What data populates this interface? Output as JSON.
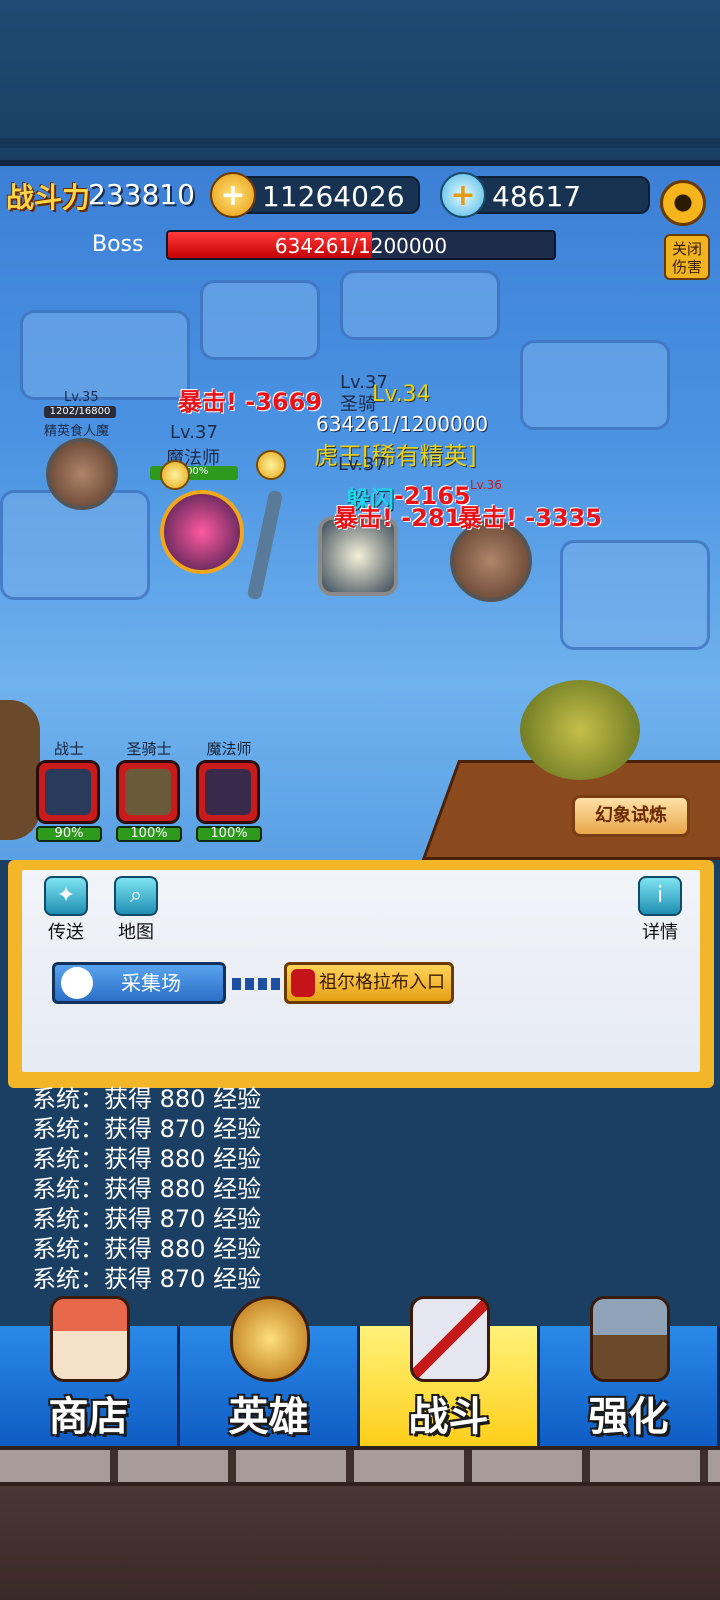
{
  "hud": {
    "power_label": "战斗力",
    "power_value": "233810",
    "gold_value": "11264026",
    "gem_value": "48617",
    "settings_icon": "gear-icon"
  },
  "boss": {
    "label": "Boss",
    "hp_text": "634261/1200000",
    "hp_fraction": 0.5286,
    "damage_toggle": "关闭伤害"
  },
  "battle": {
    "enemy_left": {
      "level": "Lv.35",
      "hp": "1202/16800",
      "name": "精英食人魔"
    },
    "mage": {
      "level": "Lv.37",
      "name": "魔法师",
      "hp_pct": "100%"
    },
    "paladin": {
      "level": "Lv.37",
      "name": "圣骑"
    },
    "boss_unit": {
      "level": "Lv.34",
      "hp": "634261/1200000",
      "name": "虎王[稀有精英]"
    },
    "warrior_level": "Lv.37",
    "enemy_right_level": "Lv.36",
    "damage_texts": [
      "暴击! -3669",
      "躲闪",
      "-2165",
      "暴击! -281",
      "暴击! -3335"
    ]
  },
  "heroes": [
    {
      "name": "战士",
      "hp": "90%",
      "hp_fraction": 0.9,
      "color": "#c81b1b"
    },
    {
      "name": "圣骑士",
      "hp": "100%",
      "hp_fraction": 1.0,
      "color": "#c81b1b"
    },
    {
      "name": "魔法师",
      "hp": "100%",
      "hp_fraction": 1.0,
      "color": "#c81b1b"
    }
  ],
  "trial_button": "幻象试炼",
  "map": {
    "teleport": "传送",
    "map": "地图",
    "details": "详情",
    "current_location": "采集场",
    "next_location": "祖尔格拉布入口"
  },
  "log": [
    "系统：获得 880 经验",
    "系统：获得 870 经验",
    "系统：获得 880 经验",
    "系统：获得 880 经验",
    "系统：获得 870 经验",
    "系统：获得 880 经验",
    "系统：获得 870 经验"
  ],
  "nav": [
    {
      "label": "商店",
      "icon": "shop-icon",
      "active": false
    },
    {
      "label": "英雄",
      "icon": "hero-helmet-icon",
      "active": false
    },
    {
      "label": "战斗",
      "icon": "crossed-swords-icon",
      "active": true
    },
    {
      "label": "强化",
      "icon": "hammer-icon",
      "active": false
    }
  ]
}
